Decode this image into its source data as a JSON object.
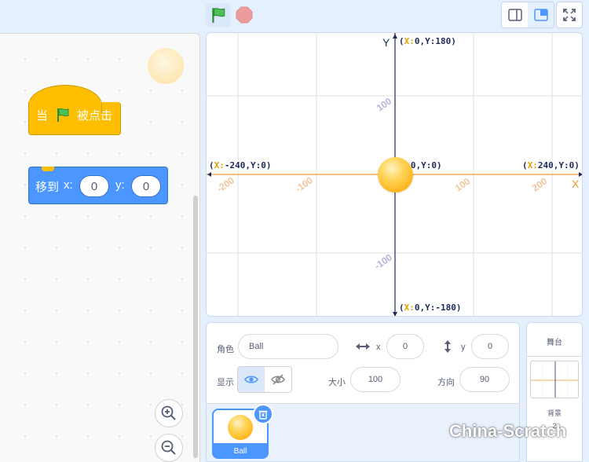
{
  "code": {
    "hat_block": {
      "prefix": "当",
      "suffix": "被点击"
    },
    "motion_block": {
      "label": "移到",
      "x_label": "x:",
      "x_value": "0",
      "y_label": "y:",
      "y_value": "0"
    }
  },
  "stage": {
    "axis_x_letter": "X",
    "axis_y_letter": "Y",
    "labels": {
      "top": {
        "x": "0",
        "y": "180"
      },
      "bottom": {
        "x": "0",
        "y": "-180"
      },
      "left": {
        "x": "-240",
        "y": "0"
      },
      "right": {
        "x": "240",
        "y": "0"
      },
      "center": {
        "x": "0",
        "y": "0"
      },
      "key_x": "X:",
      "key_y": "Y:"
    },
    "ticks_x": [
      "-200",
      "-100",
      "100",
      "200"
    ],
    "ticks_y": [
      "100",
      "-100"
    ]
  },
  "sprite_info": {
    "sprite_label": "角色",
    "sprite_name": "Ball",
    "x_label": "x",
    "x_value": "0",
    "y_label": "y",
    "y_value": "0",
    "show_label": "显示",
    "size_label": "大小",
    "size_value": "100",
    "direction_label": "方向",
    "direction_value": "90"
  },
  "sprite_list": [
    {
      "name": "Ball"
    }
  ],
  "stage_selector": {
    "title": "舞台",
    "backdrops_label": "背景",
    "backdrops_count": "2"
  },
  "watermark": "China-Scratch",
  "colors": {
    "event": "#ffbf00",
    "motion": "#4c97ff",
    "x_axis": "#e69a2e",
    "y_axis": "#1c2a5a"
  }
}
